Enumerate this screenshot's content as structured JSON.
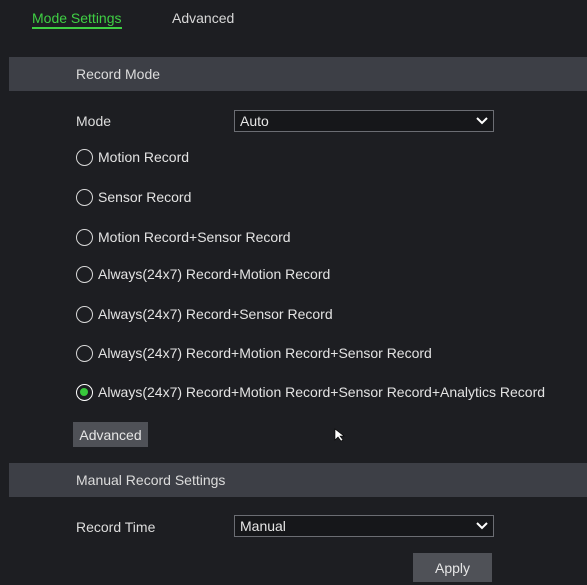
{
  "tabs": [
    {
      "label": "Mode Settings",
      "active": true
    },
    {
      "label": "Advanced",
      "active": false
    }
  ],
  "record_mode": {
    "header": "Record Mode",
    "mode_label": "Mode",
    "mode_value": "Auto",
    "options": [
      {
        "label": "Motion Record",
        "checked": false
      },
      {
        "label": "Sensor Record",
        "checked": false
      },
      {
        "label": "Motion Record+Sensor Record",
        "checked": false
      },
      {
        "label": "Always(24x7) Record+Motion Record",
        "checked": false
      },
      {
        "label": "Always(24x7) Record+Sensor Record",
        "checked": false
      },
      {
        "label": "Always(24x7) Record+Motion Record+Sensor Record",
        "checked": false
      },
      {
        "label": "Always(24x7) Record+Motion Record+Sensor Record+Analytics Record",
        "checked": true
      }
    ],
    "advanced_button": "Advanced"
  },
  "manual_record": {
    "header": "Manual Record Settings",
    "record_time_label": "Record Time",
    "record_time_value": "Manual"
  },
  "apply_button": "Apply",
  "colors": {
    "background": "#1d1e22",
    "section_header": "#3d3f46",
    "accent_green": "#3fcf44",
    "button": "#4f5157"
  },
  "icons": {
    "dropdown": "chevron-down-icon",
    "pointer": "mouse-cursor-icon"
  }
}
